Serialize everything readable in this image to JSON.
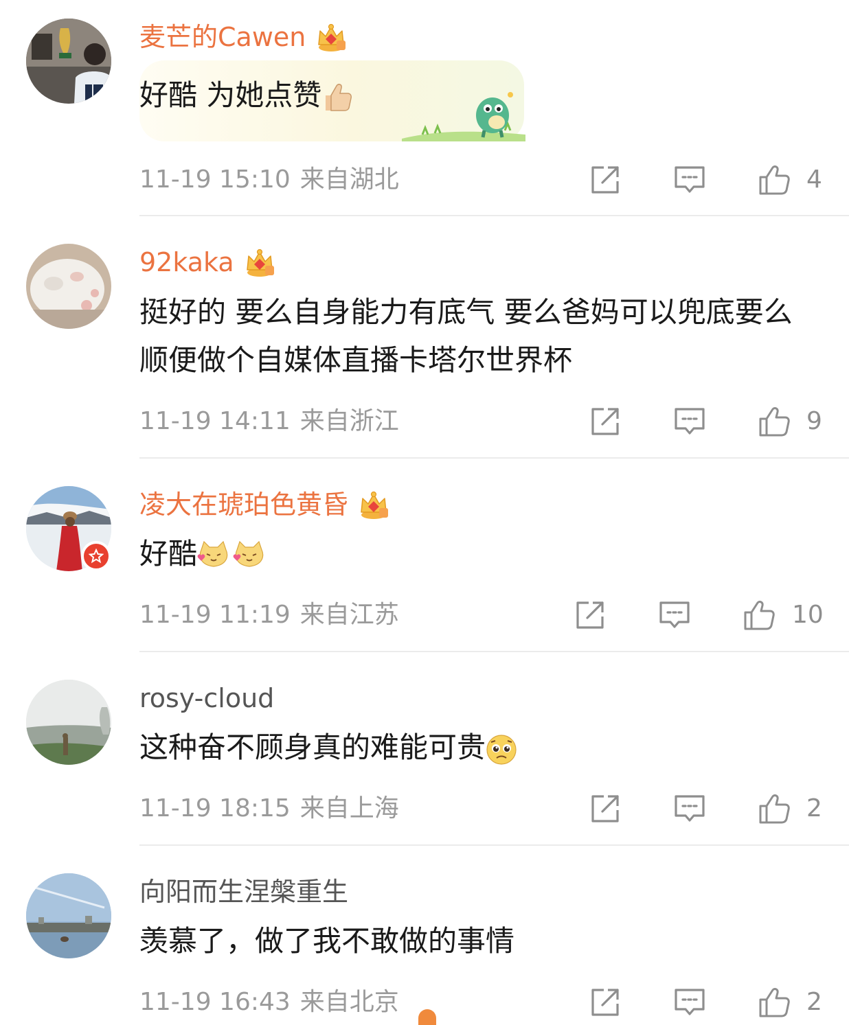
{
  "comments": [
    {
      "username": "麦芒的Cawen",
      "vip": true,
      "crown_level": "7",
      "text": "好酷 为她点赞",
      "emoji": "thumbs-up",
      "time": "11-19 15:10",
      "location": "来自湖北",
      "likes": "4"
    },
    {
      "username": "92kaka",
      "vip": true,
      "crown_level": "2",
      "text": "挺好的 要么自身能力有底气 要么爸妈可以兜底要么顺便做个自媒体直播卡塔尔世界杯",
      "time": "11-19 14:11",
      "location": "来自浙江",
      "likes": "9"
    },
    {
      "username": "凌大在琥珀色黄昏",
      "vip": true,
      "crown_level": "6",
      "text": "好酷",
      "emoji": "cat-hearts",
      "time": "11-19 11:19",
      "location": "来自江苏",
      "likes": "10"
    },
    {
      "username": "rosy-cloud",
      "vip": false,
      "text": "这种奋不顾身真的难能可贵",
      "emoji": "pleading-face",
      "time": "11-19 18:15",
      "location": "来自上海",
      "likes": "2"
    },
    {
      "username": "向阳而生涅槃重生",
      "vip": false,
      "text": "羡慕了，做了我不敢做的事情",
      "time": "11-19 16:43",
      "location": "来自北京",
      "likes": "2"
    }
  ],
  "colors": {
    "vip_name": "#eb7340",
    "plain_name": "#555555",
    "meta": "#9a9a9a",
    "icon": "#8e8e8e",
    "divider": "#ebebeb"
  }
}
